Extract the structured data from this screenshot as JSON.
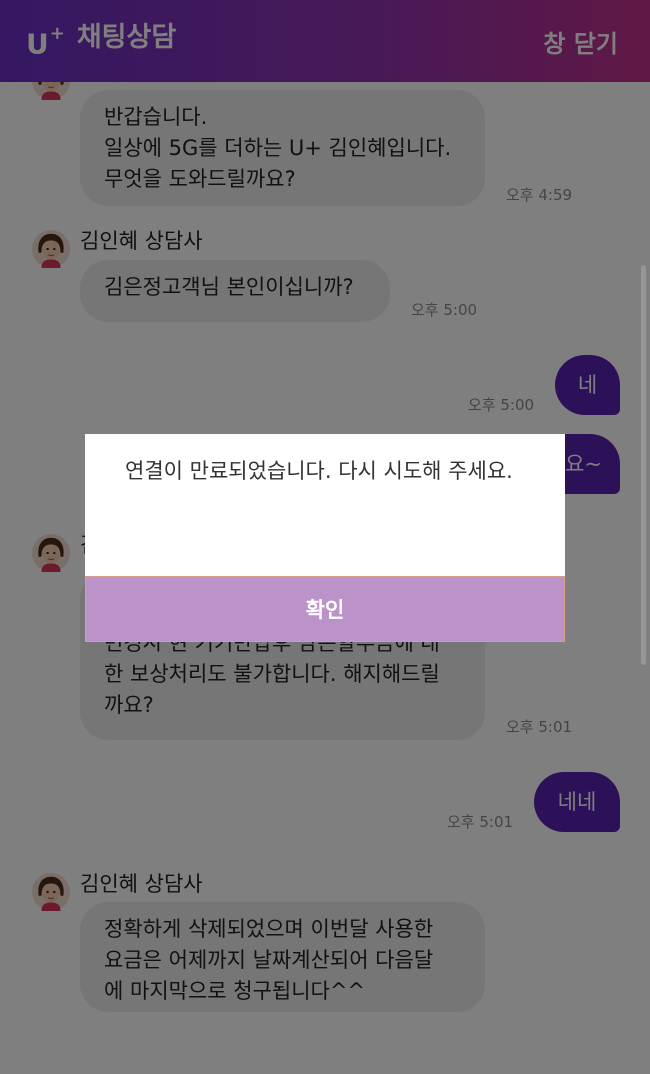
{
  "header": {
    "logo": "U",
    "logo_plus": "+",
    "title": "채팅상담",
    "close_label": "창 닫기"
  },
  "chat": {
    "agent_label": "김인혜 상담사",
    "messages": [
      {
        "text": "반갑습니다.\n일상에 5G를 더하는 U+ 김인혜입니다.\n무엇을 도와드릴까요?",
        "time": "오후 4:59"
      },
      {
        "text": "김은정고객님 본인이십니까?",
        "time": "오후 5:00"
      },
      {
        "text": "네",
        "time": "오후 5:00"
      },
      {
        "text": "요~"
      },
      {
        "text": "변경시 현 기기반납후 남은할부금에 대\n한 보상처리도 불가합니다. 해지해드릴\n까요?",
        "time": "오후 5:01"
      },
      {
        "text": "네네",
        "time": "오후 5:01"
      },
      {
        "text": "정확하게 삭제되었으며 이번달 사용한\n요금은 어제까지 날짜계산되어 다음달\n에 마지막으로 청구됩니다^^"
      }
    ]
  },
  "dialog": {
    "message": "연결이 만료되었습니다. 다시 시도해 주세요.",
    "confirm_label": "확인"
  },
  "colors": {
    "header_start": "#6a2fc4",
    "header_end": "#c0308a",
    "outgoing_bubble": "#5a23b0",
    "confirm_button": "#bb93c9"
  }
}
